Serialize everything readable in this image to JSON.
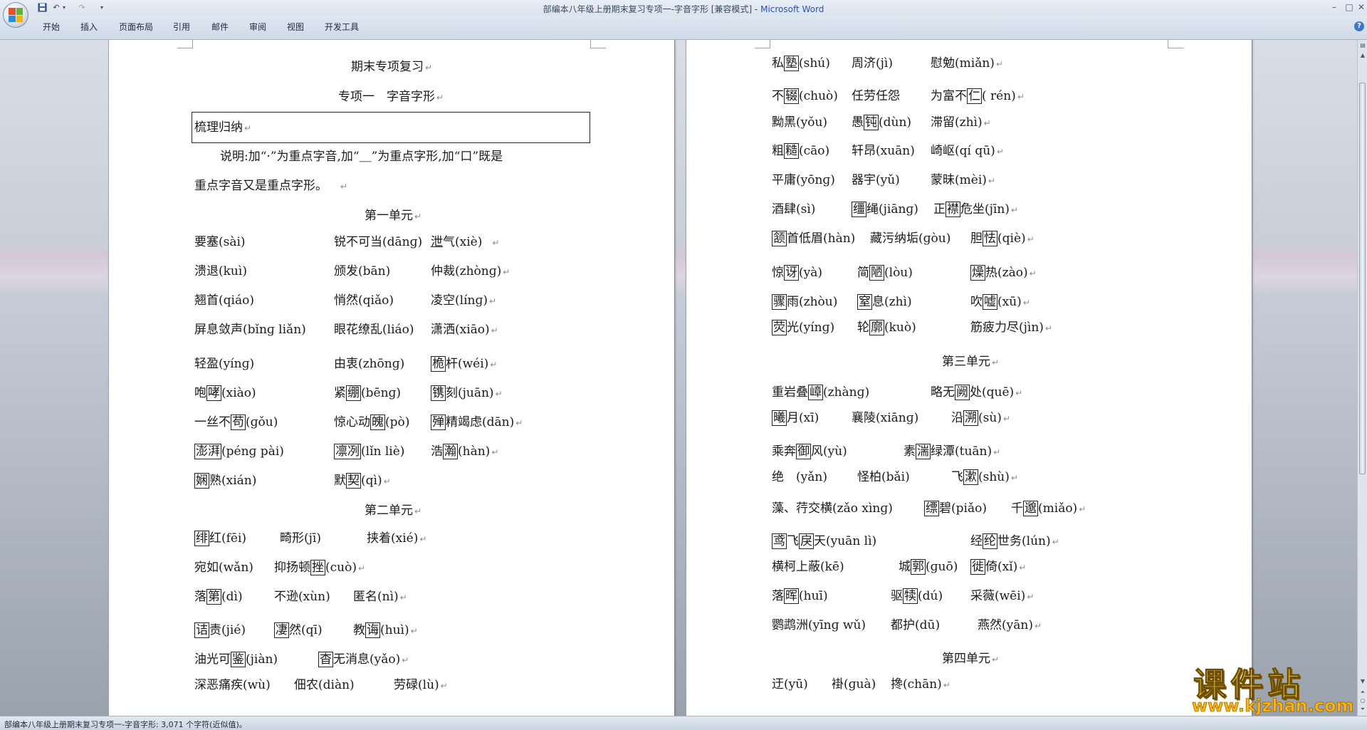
{
  "window": {
    "title": "部编本八年级上册期末复习专项一-字音字形 [兼容模式] - ",
    "app_name": "Microsoft Word",
    "min": "–",
    "max": "□",
    "close": "✕"
  },
  "qat": {
    "save_icon": "save-icon",
    "undo": "↶",
    "redo": "↷",
    "more": "▾"
  },
  "ribbon": {
    "tabs": [
      "开始",
      "插入",
      "页面布局",
      "引用",
      "邮件",
      "审阅",
      "视图",
      "开发工具"
    ],
    "help": "?"
  },
  "status": {
    "text": "部编本八年级上册期末复习专项一-字音字形: 3,071 个字符(近似值)。"
  },
  "watermark": {
    "main": "课件站",
    "url": "www.kjzhan.com"
  },
  "left_page": {
    "heading": "期末专项复习",
    "subheading": "专项一　字音字形",
    "box_title": "梳理归纳",
    "note_line1": "说明:加“·”为重点字音,加“＿”为重点字形,加“口”既是",
    "note_line2": "重点字音又是重点字形。",
    "unit1": "第一单元",
    "unit2": "第二单元"
  },
  "right_page": {
    "unit3": "第三单元",
    "unit4": "第四单元"
  },
  "entries": {
    "l_r1_1": "要塞(sài)",
    "l_r1_2": "锐不可当(dānɡ)",
    "l_r1_3a": "泄",
    "l_r1_3b": "气(xiè)",
    "l_r2_1": "溃退(kuì)",
    "l_r2_2": "颁发(bān)",
    "l_r2_3": "仲裁(zhònɡ)",
    "l_r3_1": "翘首(qiáo)",
    "l_r3_2": "悄然(qiǎo)",
    "l_r3_3": "凌空(línɡ)",
    "l_r4_1": "屏息敛声(bǐnɡ liǎn)",
    "l_r4_2": "眼花缭乱(liáo)",
    "l_r4_3": "潇洒(xiāo)",
    "l_r5_1": "轻盈(yínɡ)",
    "l_r5_2": "由衷(zhōnɡ)",
    "l_r5_3b": "桅",
    "l_r5_3c": "杆(wéi)",
    "l_r6_1a": "咆",
    "l_r6_1b": "哮",
    "l_r6_1c": "(xiào)",
    "l_r6_2a": "紧",
    "l_r6_2b": "绷",
    "l_r6_2c": "(bēnɡ)",
    "l_r6_3b": "镌",
    "l_r6_3c": "刻(juān)",
    "l_r7_1a": "一丝不",
    "l_r7_1b": "苟",
    "l_r7_1c": "(ɡǒu)",
    "l_r7_2a": "惊心动",
    "l_r7_2b": "魄",
    "l_r7_2c": "(pò)",
    "l_r7_3b": "殚",
    "l_r7_3c": "精竭虑(dān)",
    "l_r8_1b": "澎湃",
    "l_r8_1c": "(pénɡ pài)",
    "l_r8_2b": "凛冽",
    "l_r8_2c": "(lǐn liè)",
    "l_r8_3a": "浩",
    "l_r8_3b": "瀚",
    "l_r8_3c": "(hàn)",
    "l_r9_1b": "娴",
    "l_r9_1c": "熟(xián)",
    "l_r9_2a": "默",
    "l_r9_2b": "契",
    "l_r9_2c": "(qì)",
    "l_u2_r1_1b": "绯",
    "l_u2_r1_1c": "红(fēi)",
    "l_u2_r1_2": "畸形(jī)",
    "l_u2_r1_3": "挟着(xié)",
    "l_u2_r2_1": "宛如(wǎn)",
    "l_u2_r2_2a": "抑扬顿",
    "l_u2_r2_2b": "挫",
    "l_u2_r2_2c": "(cuò)",
    "l_u2_r3_1a": "落",
    "l_u2_r3_1b": "第",
    "l_u2_r3_1c": "(dì)",
    "l_u2_r3_2": "不逊(xùn)",
    "l_u2_r3_3": "匿名(nì)",
    "l_u2_r4_1b": "诘",
    "l_u2_r4_1c": "责(jié)",
    "l_u2_r4_2b": "凄",
    "l_u2_r4_2c": "然(qī)",
    "l_u2_r4_3a": "教",
    "l_u2_r4_3b": "诲",
    "l_u2_r4_3c": "(huì)",
    "l_u2_r5_1a": "油光可",
    "l_u2_r5_1b": "鉴",
    "l_u2_r5_1c": "(jiàn)",
    "l_u2_r5_2b": "杳",
    "l_u2_r5_2c": "无消息(yǎo)",
    "l_u2_r6_1": "深恶痛疾(wù)",
    "l_u2_r6_2": "佃农(diàn)",
    "l_u2_r6_3": "劳碌(lù)",
    "r_r1_1a": "私",
    "r_r1_1b": "塾",
    "r_r1_1c": "(shú)",
    "r_r1_2": "周济(jì)",
    "r_r1_3": "慰勉(miǎn)",
    "r_r2_1a": "不",
    "r_r2_1b": "辍",
    "r_r2_1c": "(chuò)",
    "r_r2_2": "任劳任怨",
    "r_r2_3a": "为富不",
    "r_r2_3b": "仁",
    "r_r2_3c": "( rén)",
    "r_r3_1": "黝黑(yǒu)",
    "r_r3_2a": "愚",
    "r_r3_2b": "钝",
    "r_r3_2c": "(dùn)",
    "r_r3_3": "滞留(zhì)",
    "r_r4_1a": "粗",
    "r_r4_1b": "糙",
    "r_r4_1c": "(cāo)",
    "r_r4_2": "轩昂(xuān)",
    "r_r4_3": "崎岖(qí qū)",
    "r_r5_1": "平庸(yōnɡ)",
    "r_r5_2": "器宇(yǔ)",
    "r_r5_3": "蒙昧(mèi)",
    "r_r6_1": "酒肆(sì)",
    "r_r6_2b": "缰",
    "r_r6_2c": "绳(jiānɡ)",
    "r_r6_3a": "正",
    "r_r6_3b": "襟",
    "r_r6_3c": "危坐(jīn)",
    "r_r7_1b": "颔",
    "r_r7_1c": "首低眉(hàn)",
    "r_r7_2": "藏污纳垢(ɡòu)",
    "r_r7_3a": "胆",
    "r_r7_3b": "怯",
    "r_r7_3c": "(qiè)",
    "r_r8_1a": "惊",
    "r_r8_1b": "讶",
    "r_r8_1c": "(yà)",
    "r_r8_2a": "简",
    "r_r8_2b": "陋",
    "r_r8_2c": "(lòu)",
    "r_r8_3b": "燥",
    "r_r8_3c": "热(zào)",
    "r_r9_1b": "骤",
    "r_r9_1c": "雨(zhòu)",
    "r_r9_2b": "窒",
    "r_r9_2c": "息(zhì)",
    "r_r9_3a": "吹",
    "r_r9_3b": "嘘",
    "r_r9_3c": "(xū)",
    "r_r10_1b": "荧",
    "r_r10_1c": "光(yínɡ)",
    "r_r10_2a": "轮",
    "r_r10_2b": "廓",
    "r_r10_2c": "(kuò)",
    "r_r10_3": "筋疲力尽(jìn)",
    "r_u3_r1_1a": "重岩叠",
    "r_u3_r1_1b": "嶂",
    "r_u3_r1_1c": "(zhànɡ)",
    "r_u3_r1_2a": "略无",
    "r_u3_r1_2b": "阙",
    "r_u3_r1_2c": "处(quē)",
    "r_u3_r2_1b": "曦",
    "r_u3_r2_1c": "月(xī)",
    "r_u3_r2_2": "襄陵(xiānɡ)",
    "r_u3_r2_3a": "沿",
    "r_u3_r2_3b": "溯",
    "r_u3_r2_3c": "(sù)",
    "r_u3_r3_1a": "乘奔",
    "r_u3_r3_1b": "御",
    "r_u3_r3_1c": "风(yù)",
    "r_u3_r3_2a": "素",
    "r_u3_r3_2b": "湍",
    "r_u3_r3_2c": "绿潭(tuān)",
    "r_u3_r4_1": "绝　(yǎn)",
    "r_u3_r4_2": "怪柏(bǎi)",
    "r_u3_r4_3a": "飞",
    "r_u3_r4_3b": "漱",
    "r_u3_r4_3c": "(shù)",
    "r_u3_r5_1": "藻、荇交横(zǎo xìnɡ)",
    "r_u3_r5_2b": "缥",
    "r_u3_r5_2c": "碧(piǎo)",
    "r_u3_r5_3a": "千",
    "r_u3_r5_3b": "邈",
    "r_u3_r5_3c": "(miǎo)",
    "r_u3_r6_1b": "鸢",
    "r_u3_r6_1c": "飞",
    "r_u3_r6_1d": "戾",
    "r_u3_r6_1e": "天(yuān lì)",
    "r_u3_r6_2a": "经",
    "r_u3_r6_2b": "纶",
    "r_u3_r6_2c": "世务(lún)",
    "r_u3_r7_1": "横柯上蔽(kē)",
    "r_u3_r7_2a": "城",
    "r_u3_r7_2b": "郭",
    "r_u3_r7_2c": "(ɡuō)",
    "r_u3_r7_3b": "徙",
    "r_u3_r7_3c": "倚(xǐ)",
    "r_u3_r8_1a": "落",
    "r_u3_r8_1b": "晖",
    "r_u3_r8_1c": "(huī)",
    "r_u3_r8_2a": "驱",
    "r_u3_r8_2b": "犊",
    "r_u3_r8_2c": "(dú)",
    "r_u3_r8_3": "采薇(wēi)",
    "r_u3_r9_1": "鹦鹉洲(yīnɡ wǔ)",
    "r_u3_r9_2": "都护(dū)",
    "r_u3_r9_3": "燕然(yān)",
    "r_u4_r1_1": "迂(yū)",
    "r_u4_r1_2": "褂(ɡuà)",
    "r_u4_r1_3": "搀(chān)"
  }
}
